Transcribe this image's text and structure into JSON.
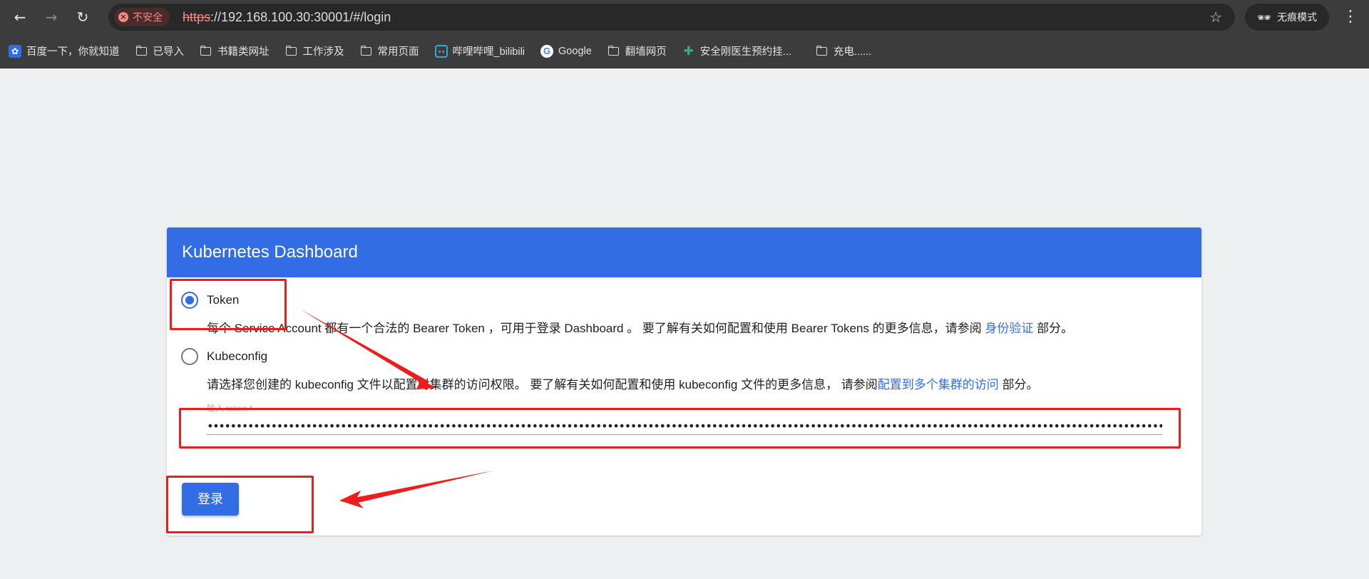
{
  "browser": {
    "back_icon": "arrow-left-icon",
    "forward_icon": "arrow-right-icon",
    "reload_icon": "reload-icon",
    "security_label": "不安全",
    "url_scheme": "https",
    "url_rest": "://192.168.100.30:30001/#/login",
    "incognito_label": "无痕模式",
    "accent_warning": "#f28b82"
  },
  "bookmarks": [
    {
      "label": "百度一下，你就知道",
      "icon": "baidu-icon"
    },
    {
      "label": "已导入",
      "icon": "folder-icon"
    },
    {
      "label": "书籍类网址",
      "icon": "folder-icon"
    },
    {
      "label": "工作涉及",
      "icon": "folder-icon"
    },
    {
      "label": "常用页面",
      "icon": "folder-icon"
    },
    {
      "label": "哔哩哔哩_bilibili",
      "icon": "bilibili-icon"
    },
    {
      "label": "Google",
      "icon": "google-icon"
    },
    {
      "label": "翻墙网页",
      "icon": "folder-icon"
    },
    {
      "label": "安全刚医生预约挂...",
      "icon": "medical-icon"
    },
    {
      "label": "充电......",
      "icon": "folder-icon"
    }
  ],
  "login": {
    "title": "Kubernetes Dashboard",
    "brand_color": "#326de6",
    "token_option": "Token",
    "token_desc_pre": "每个 Service Account 都有一个合法的 Bearer Token ，可用于登录 Dashboard 。 要了解有关如何配置和使用 Bearer Tokens 的更多信息，请参阅 ",
    "token_desc_link": "身份验证",
    "token_desc_post": " 部分。",
    "kubeconfig_option": "Kubeconfig",
    "kubeconfig_desc_pre": "请选择您创建的 kubeconfig 文件以配置对集群的访问权限。 要了解有关如何配置和使用 kubeconfig 文件的更多信息， 请参阅",
    "kubeconfig_desc_link": "配置到多个集群的访问",
    "kubeconfig_desc_post": " 部分。",
    "selected_option": "Token",
    "token_field_label": "输入 token *",
    "token_value": "••••••••••••••••••••••••••••••••••••••••••••••••••••••••••••••••••••••••••••••••••••••••••••••••••••••••••••••••••••••••••••••••••••••••••••••••••••••••••••••••••••••••••••••••••••••",
    "login_button": "登录"
  },
  "annotation_color": "#ee1c1c"
}
